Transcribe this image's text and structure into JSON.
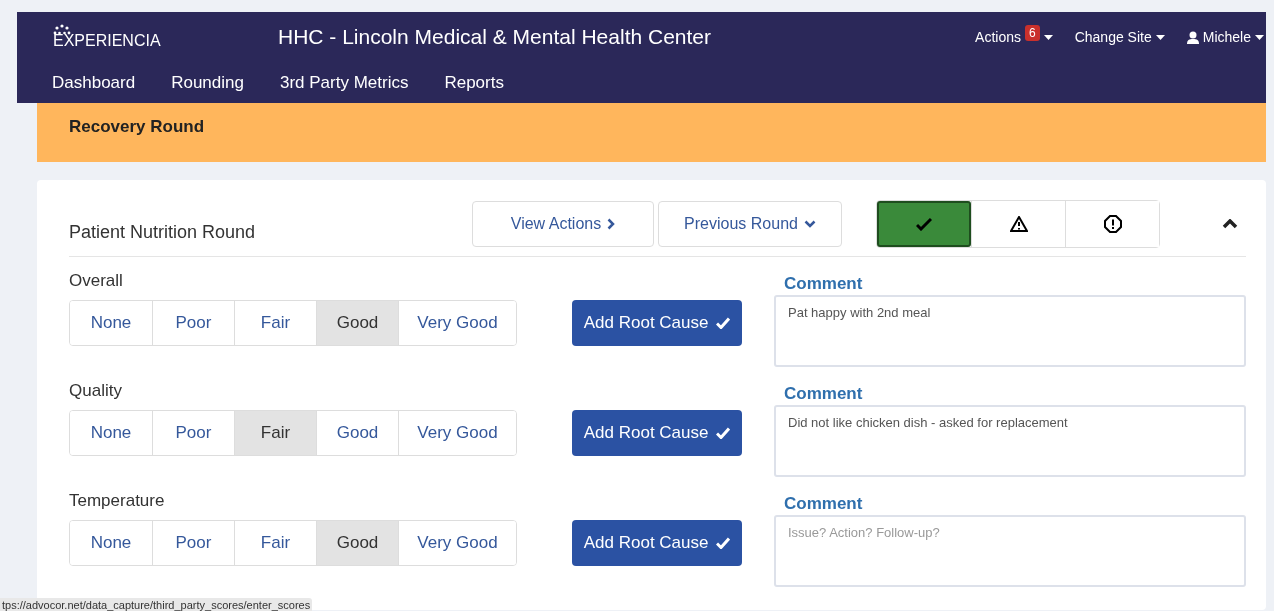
{
  "header": {
    "logo": "EXPERIENCIA",
    "title": "HHC - Lincoln Medical & Mental Health Center",
    "actions": {
      "label": "Actions",
      "badge": "6"
    },
    "change_site": "Change Site",
    "user": "Michele"
  },
  "nav": [
    "Dashboard",
    "Rounding",
    "3rd Party Metrics",
    "Reports"
  ],
  "banner": "Recovery Round",
  "card": {
    "title": "Patient Nutrition Round",
    "view_actions": "View Actions",
    "previous_round": "Previous Round",
    "status": [
      {
        "kind": "check",
        "selected": true
      },
      {
        "kind": "warning",
        "selected": false
      },
      {
        "kind": "alert",
        "selected": false
      }
    ],
    "expanded": true,
    "rows": [
      {
        "label": "Overall",
        "options": [
          {
            "label": "None",
            "selected": false
          },
          {
            "label": "Poor",
            "selected": false
          },
          {
            "label": "Fair",
            "selected": false
          },
          {
            "label": "Good",
            "selected": true
          },
          {
            "label": "Very Good",
            "selected": false
          }
        ],
        "root_cause": "Add Root Cause",
        "comment_label": "Comment",
        "comment": "Pat happy with 2nd meal"
      },
      {
        "label": "Quality",
        "options": [
          {
            "label": "None",
            "selected": false
          },
          {
            "label": "Poor",
            "selected": false
          },
          {
            "label": "Fair",
            "selected": true
          },
          {
            "label": "Good",
            "selected": false
          },
          {
            "label": "Very Good",
            "selected": false
          }
        ],
        "root_cause": "Add Root Cause",
        "comment_label": "Comment",
        "comment": "Did not like chicken dish - asked for replacement"
      },
      {
        "label": "Temperature",
        "options": [
          {
            "label": "None",
            "selected": false
          },
          {
            "label": "Poor",
            "selected": false
          },
          {
            "label": "Fair",
            "selected": false
          },
          {
            "label": "Good",
            "selected": true
          },
          {
            "label": "Very Good",
            "selected": false
          }
        ],
        "root_cause": "Add Root Cause",
        "comment_label": "Comment",
        "placeholder": "Issue? Action? Follow-up?"
      }
    ]
  },
  "status_url": "tps://advocor.net/data_capture/third_party_scores/enter_scores"
}
